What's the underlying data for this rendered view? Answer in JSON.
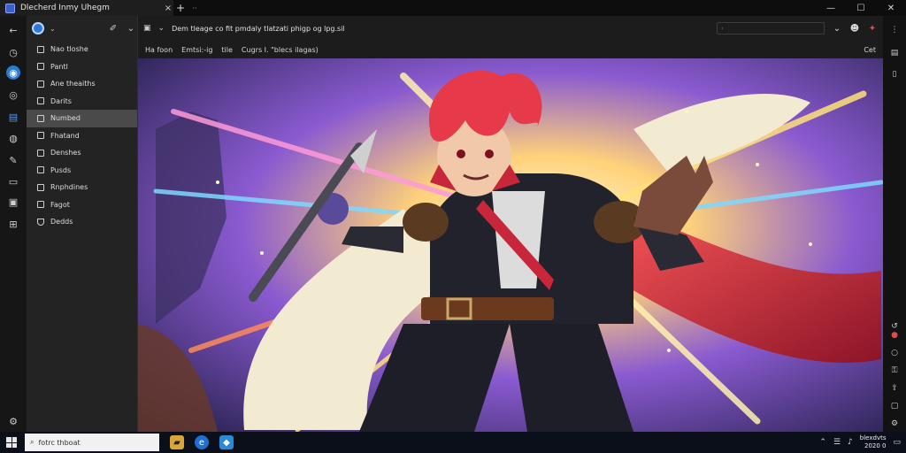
{
  "window": {
    "tab_title": "Dlecherd Inmy Uhegm",
    "tab_close": "×",
    "new_tab": "+",
    "tab_menu": "··",
    "minimize": "—",
    "maximize": "☐",
    "close": "✕"
  },
  "rail": {
    "icons": [
      "back-icon",
      "clock-icon",
      "globe-icon",
      "compass-icon",
      "clipboard-icon",
      "palette-icon",
      "brush-icon",
      "book-icon",
      "wallet-icon",
      "apps-icon",
      "settings-icon"
    ]
  },
  "sidebar": {
    "items": [
      {
        "label": "Nao tloshe",
        "selected": false
      },
      {
        "label": "Pantl",
        "selected": false
      },
      {
        "label": "Ane theaiths",
        "selected": false
      },
      {
        "label": "Darits",
        "selected": false
      },
      {
        "label": "Numbed",
        "selected": true
      },
      {
        "label": "Fhatand",
        "selected": false
      },
      {
        "label": "Denshes",
        "selected": false
      },
      {
        "label": "Pusds",
        "selected": false
      },
      {
        "label": "Rnphdines",
        "selected": false
      },
      {
        "label": "Fagot",
        "selected": false
      },
      {
        "label": "Dedds",
        "selected": false
      }
    ]
  },
  "address": {
    "url": "Dem tleage co fit pmdaly tlatzati phigp og lpg.sil",
    "search_text": "·"
  },
  "crumbs": {
    "items": [
      "Ha foon",
      "Emtsi:-ig",
      "tile",
      "Cugrs I. \"blecs ilagas)"
    ],
    "right": "Cet"
  },
  "taskbar": {
    "search_placeholder": "fotrc thboat",
    "clock_line1": "blexdvts",
    "clock_line2": "2020 0"
  },
  "colors": {
    "accent": "#2a7bd1",
    "hair": "#e63a4a",
    "cape": "#c8263a"
  }
}
